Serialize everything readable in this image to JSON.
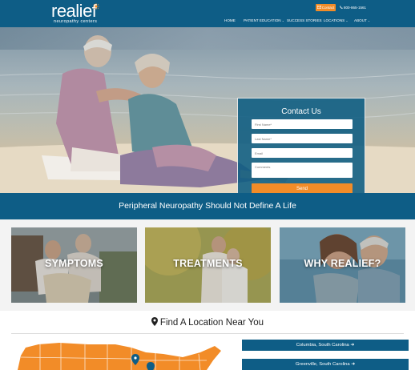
{
  "brand": {
    "logo_text": "realief",
    "tagline": "neuropathy centers",
    "colors": {
      "primary": "#0e5d86",
      "accent": "#f28c28"
    }
  },
  "header": {
    "contact_label": "Contact",
    "phone": "800-865-1561",
    "nav": [
      {
        "label": "HOME"
      },
      {
        "label": "PATIENT EDUCATION",
        "has_dropdown": true
      },
      {
        "label": "SUCCESS STORIES"
      },
      {
        "label": "LOCATIONS",
        "has_dropdown": true
      },
      {
        "label": "ABOUT",
        "has_dropdown": true
      }
    ]
  },
  "contact_form": {
    "title": "Contact Us",
    "first_name_placeholder": "First Name*",
    "last_name_placeholder": "Last Name*",
    "email_placeholder": "Email",
    "comments_placeholder": "Comments",
    "send_label": "Send"
  },
  "banner": {
    "text": "Peripheral Neuropathy Should Not Define A Life"
  },
  "cards": [
    {
      "label": "SYMPTOMS"
    },
    {
      "label": "TREATMENTS"
    },
    {
      "label": "WHY REALIEF?"
    }
  ],
  "find_location": {
    "title": "Find A Location Near You",
    "locations": [
      {
        "label": "Columbia, South Carolina"
      },
      {
        "label": "Greenville, South Carolina"
      }
    ]
  }
}
